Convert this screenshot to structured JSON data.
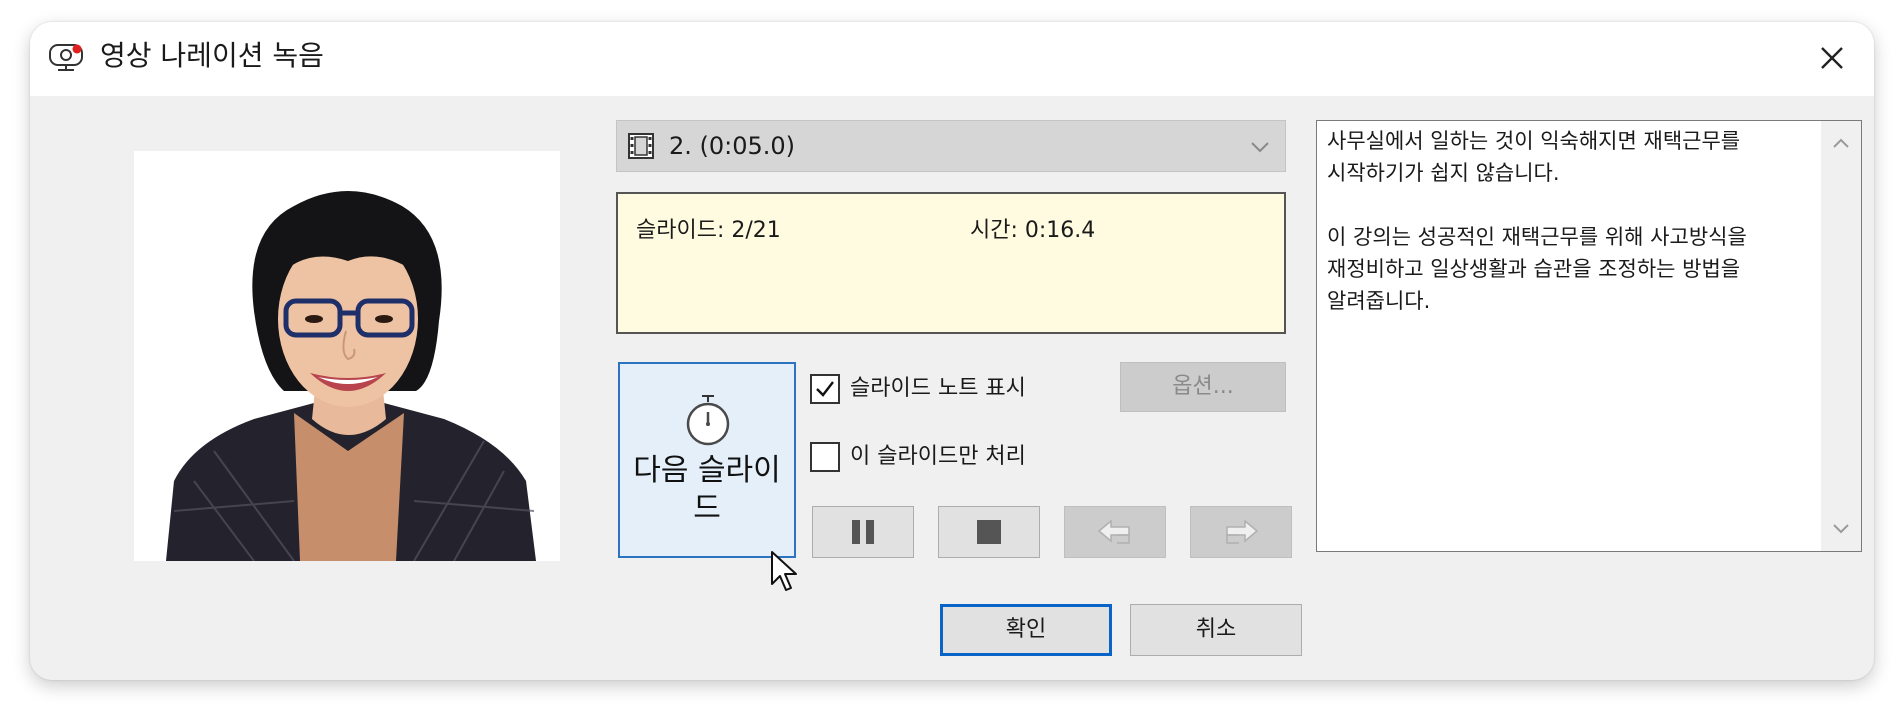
{
  "window": {
    "title": "영상 나레이션 녹음",
    "title_icon": "webcam-icon",
    "close_icon": "close-icon"
  },
  "slide_select": {
    "icon": "film-strip-icon",
    "value": "2. (0:05.0)",
    "chevron_icon": "chevron-down-icon"
  },
  "info": {
    "slide_text": "슬라이드: 2/21",
    "time_text": "시간: 0:16.4"
  },
  "next_slide_button": {
    "icon": "stopwatch-icon",
    "label": "다음 슬라이드"
  },
  "checkboxes": {
    "show_notes": {
      "label": "슬라이드 노트 표시",
      "checked": true
    },
    "this_slide_only": {
      "label": "이 슬라이드만 처리",
      "checked": false
    }
  },
  "options_button": {
    "label": "옵션..."
  },
  "controls": {
    "pause_icon": "pause-icon",
    "stop_icon": "stop-icon",
    "prev_icon": "arrow-left-icon",
    "next_icon": "arrow-right-icon"
  },
  "notes": {
    "text": "사무실에서 일하는 것이 익숙해지면 재택근무를\n시작하기가 쉽지 않습니다.\n\n이 강의는 성공적인 재택근무를 위해 사고방식을\n재정비하고 일상생활과 습관을 조정하는 방법을\n알려줍니다."
  },
  "buttons": {
    "ok": "확인",
    "cancel": "취소"
  },
  "colors": {
    "dialog_bg": "#f0f0f0",
    "info_bg": "#fffbe0",
    "accent": "#0a64c8",
    "next_btn_bg": "#e4eff9"
  }
}
